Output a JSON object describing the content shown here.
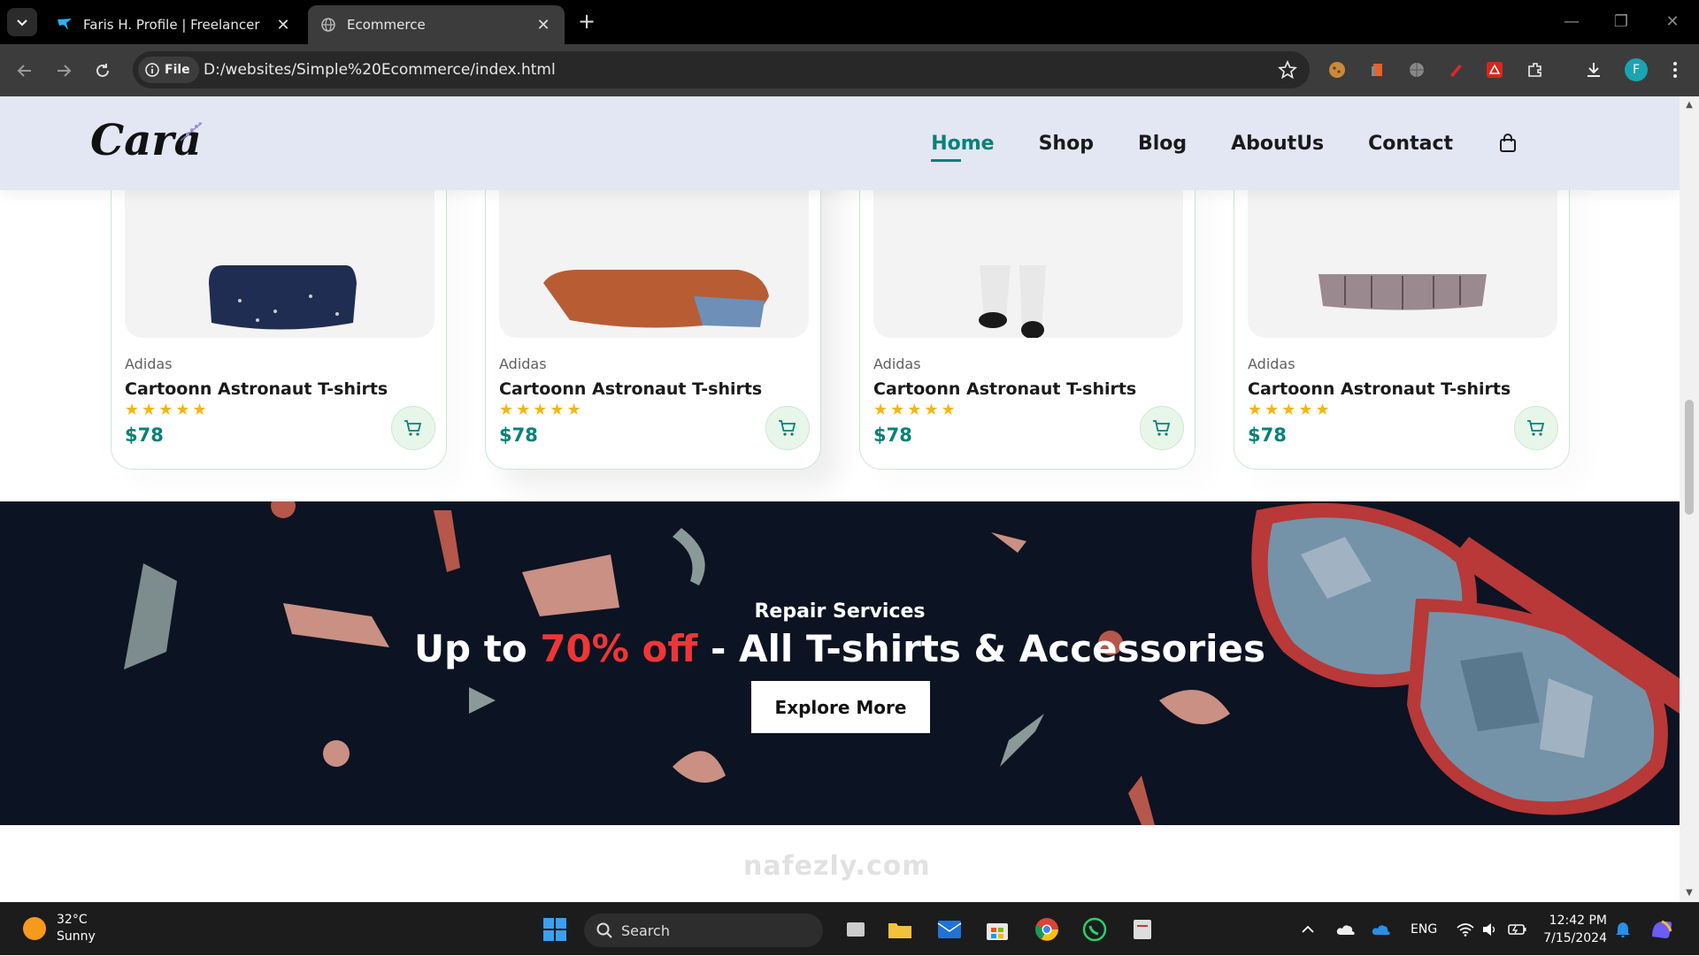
{
  "browser": {
    "tabs": [
      {
        "title": "Faris H. Profile | Freelancer",
        "active": false
      },
      {
        "title": "Ecommerce",
        "active": true
      }
    ],
    "security_chip": "File",
    "url": "D:/websites/Simple%20Ecommerce/index.html",
    "profile_initial": "F"
  },
  "site": {
    "logo": "Cara",
    "nav": [
      {
        "label": "Home",
        "active": true
      },
      {
        "label": "Shop",
        "active": false
      },
      {
        "label": "Blog",
        "active": false
      },
      {
        "label": "AboutUs",
        "active": false
      },
      {
        "label": "Contact",
        "active": false
      }
    ],
    "products": [
      {
        "brand": "Adidas",
        "name": "Cartoonn Astronaut T-shirts",
        "rating": 5,
        "stars": "★★★★★",
        "price": "$78"
      },
      {
        "brand": "Adidas",
        "name": "Cartoonn Astronaut T-shirts",
        "rating": 5,
        "stars": "★★★★★",
        "price": "$78"
      },
      {
        "brand": "Adidas",
        "name": "Cartoonn Astronaut T-shirts",
        "rating": 5,
        "stars": "★★★★★",
        "price": "$78"
      },
      {
        "brand": "Adidas",
        "name": "Cartoonn Astronaut T-shirts",
        "rating": 5,
        "stars": "★★★★★",
        "price": "$78"
      }
    ],
    "banner": {
      "subtitle": "Repair Services",
      "title_prefix": "Up to ",
      "title_highlight": "70% off",
      "title_suffix": " - All T-shirts & Accessories",
      "button": "Explore More"
    },
    "colors": {
      "accent": "#088178",
      "header_bg": "#e3e6f3",
      "banner_bg": "#0c1322",
      "highlight": "#ef3636",
      "star": "#f3b518"
    }
  },
  "taskbar": {
    "weather_temp": "32°C",
    "weather_desc": "Sunny",
    "search_label": "Search",
    "language": "ENG",
    "time": "12:42 PM",
    "date": "7/15/2024"
  },
  "watermark": "nafezly.com"
}
